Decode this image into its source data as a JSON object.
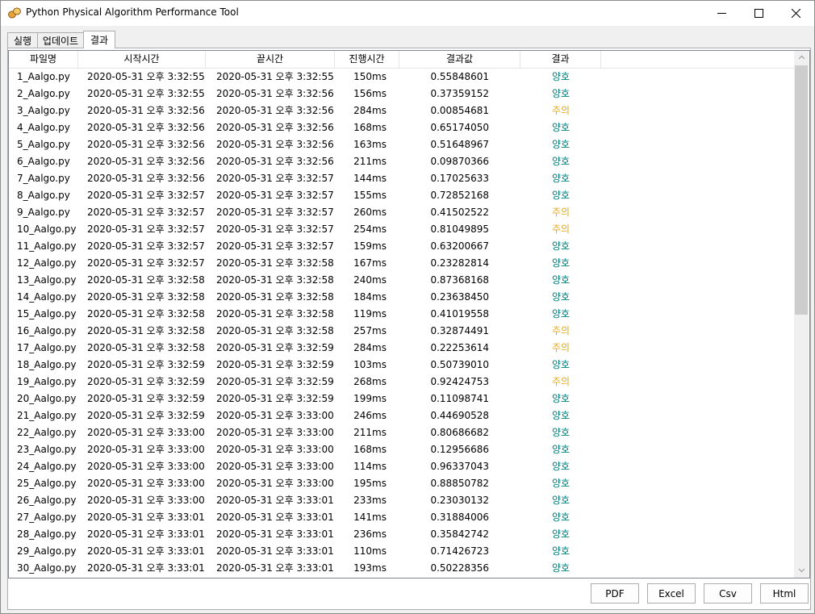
{
  "window": {
    "title": "Python Physical Algorithm Performance Tool"
  },
  "tabs": [
    {
      "label": "실행"
    },
    {
      "label": "업데이트"
    },
    {
      "label": "결과"
    }
  ],
  "columns": [
    "파일명",
    "시작시간",
    "끝시간",
    "진행시간",
    "결과값",
    "결과"
  ],
  "status_colors": {
    "good": "#007a7a",
    "caution": "#e6a817"
  },
  "rows": [
    {
      "file": "1_Aalgo.py",
      "start": "2020-05-31 오후 3:32:55",
      "end": "2020-05-31 오후 3:32:55",
      "duration": "150ms",
      "value": "0.55848601",
      "result": "양호",
      "status": "good"
    },
    {
      "file": "2_Aalgo.py",
      "start": "2020-05-31 오후 3:32:55",
      "end": "2020-05-31 오후 3:32:56",
      "duration": "156ms",
      "value": "0.37359152",
      "result": "양호",
      "status": "good"
    },
    {
      "file": "3_Aalgo.py",
      "start": "2020-05-31 오후 3:32:56",
      "end": "2020-05-31 오후 3:32:56",
      "duration": "284ms",
      "value": "0.00854681",
      "result": "주의",
      "status": "caution"
    },
    {
      "file": "4_Aalgo.py",
      "start": "2020-05-31 오후 3:32:56",
      "end": "2020-05-31 오후 3:32:56",
      "duration": "168ms",
      "value": "0.65174050",
      "result": "양호",
      "status": "good"
    },
    {
      "file": "5_Aalgo.py",
      "start": "2020-05-31 오후 3:32:56",
      "end": "2020-05-31 오후 3:32:56",
      "duration": "163ms",
      "value": "0.51648967",
      "result": "양호",
      "status": "good"
    },
    {
      "file": "6_Aalgo.py",
      "start": "2020-05-31 오후 3:32:56",
      "end": "2020-05-31 오후 3:32:56",
      "duration": "211ms",
      "value": "0.09870366",
      "result": "양호",
      "status": "good"
    },
    {
      "file": "7_Aalgo.py",
      "start": "2020-05-31 오후 3:32:56",
      "end": "2020-05-31 오후 3:32:57",
      "duration": "144ms",
      "value": "0.17025633",
      "result": "양호",
      "status": "good"
    },
    {
      "file": "8_Aalgo.py",
      "start": "2020-05-31 오후 3:32:57",
      "end": "2020-05-31 오후 3:32:57",
      "duration": "155ms",
      "value": "0.72852168",
      "result": "양호",
      "status": "good"
    },
    {
      "file": "9_Aalgo.py",
      "start": "2020-05-31 오후 3:32:57",
      "end": "2020-05-31 오후 3:32:57",
      "duration": "260ms",
      "value": "0.41502522",
      "result": "주의",
      "status": "caution"
    },
    {
      "file": "10_Aalgo.py",
      "start": "2020-05-31 오후 3:32:57",
      "end": "2020-05-31 오후 3:32:57",
      "duration": "254ms",
      "value": "0.81049895",
      "result": "주의",
      "status": "caution"
    },
    {
      "file": "11_Aalgo.py",
      "start": "2020-05-31 오후 3:32:57",
      "end": "2020-05-31 오후 3:32:57",
      "duration": "159ms",
      "value": "0.63200667",
      "result": "양호",
      "status": "good"
    },
    {
      "file": "12_Aalgo.py",
      "start": "2020-05-31 오후 3:32:57",
      "end": "2020-05-31 오후 3:32:58",
      "duration": "167ms",
      "value": "0.23282814",
      "result": "양호",
      "status": "good"
    },
    {
      "file": "13_Aalgo.py",
      "start": "2020-05-31 오후 3:32:58",
      "end": "2020-05-31 오후 3:32:58",
      "duration": "240ms",
      "value": "0.87368168",
      "result": "양호",
      "status": "good"
    },
    {
      "file": "14_Aalgo.py",
      "start": "2020-05-31 오후 3:32:58",
      "end": "2020-05-31 오후 3:32:58",
      "duration": "184ms",
      "value": "0.23638450",
      "result": "양호",
      "status": "good"
    },
    {
      "file": "15_Aalgo.py",
      "start": "2020-05-31 오후 3:32:58",
      "end": "2020-05-31 오후 3:32:58",
      "duration": "119ms",
      "value": "0.41019558",
      "result": "양호",
      "status": "good"
    },
    {
      "file": "16_Aalgo.py",
      "start": "2020-05-31 오후 3:32:58",
      "end": "2020-05-31 오후 3:32:58",
      "duration": "257ms",
      "value": "0.32874491",
      "result": "주의",
      "status": "caution"
    },
    {
      "file": "17_Aalgo.py",
      "start": "2020-05-31 오후 3:32:58",
      "end": "2020-05-31 오후 3:32:59",
      "duration": "284ms",
      "value": "0.22253614",
      "result": "주의",
      "status": "caution"
    },
    {
      "file": "18_Aalgo.py",
      "start": "2020-05-31 오후 3:32:59",
      "end": "2020-05-31 오후 3:32:59",
      "duration": "103ms",
      "value": "0.50739010",
      "result": "양호",
      "status": "good"
    },
    {
      "file": "19_Aalgo.py",
      "start": "2020-05-31 오후 3:32:59",
      "end": "2020-05-31 오후 3:32:59",
      "duration": "268ms",
      "value": "0.92424753",
      "result": "주의",
      "status": "caution"
    },
    {
      "file": "20_Aalgo.py",
      "start": "2020-05-31 오후 3:32:59",
      "end": "2020-05-31 오후 3:32:59",
      "duration": "199ms",
      "value": "0.11098741",
      "result": "양호",
      "status": "good"
    },
    {
      "file": "21_Aalgo.py",
      "start": "2020-05-31 오후 3:32:59",
      "end": "2020-05-31 오후 3:33:00",
      "duration": "246ms",
      "value": "0.44690528",
      "result": "양호",
      "status": "good"
    },
    {
      "file": "22_Aalgo.py",
      "start": "2020-05-31 오후 3:33:00",
      "end": "2020-05-31 오후 3:33:00",
      "duration": "211ms",
      "value": "0.80686682",
      "result": "양호",
      "status": "good"
    },
    {
      "file": "23_Aalgo.py",
      "start": "2020-05-31 오후 3:33:00",
      "end": "2020-05-31 오후 3:33:00",
      "duration": "168ms",
      "value": "0.12956686",
      "result": "양호",
      "status": "good"
    },
    {
      "file": "24_Aalgo.py",
      "start": "2020-05-31 오후 3:33:00",
      "end": "2020-05-31 오후 3:33:00",
      "duration": "114ms",
      "value": "0.96337043",
      "result": "양호",
      "status": "good"
    },
    {
      "file": "25_Aalgo.py",
      "start": "2020-05-31 오후 3:33:00",
      "end": "2020-05-31 오후 3:33:00",
      "duration": "195ms",
      "value": "0.88850782",
      "result": "양호",
      "status": "good"
    },
    {
      "file": "26_Aalgo.py",
      "start": "2020-05-31 오후 3:33:00",
      "end": "2020-05-31 오후 3:33:01",
      "duration": "233ms",
      "value": "0.23030132",
      "result": "양호",
      "status": "good"
    },
    {
      "file": "27_Aalgo.py",
      "start": "2020-05-31 오후 3:33:01",
      "end": "2020-05-31 오후 3:33:01",
      "duration": "141ms",
      "value": "0.31884006",
      "result": "양호",
      "status": "good"
    },
    {
      "file": "28_Aalgo.py",
      "start": "2020-05-31 오후 3:33:01",
      "end": "2020-05-31 오후 3:33:01",
      "duration": "236ms",
      "value": "0.35842742",
      "result": "양호",
      "status": "good"
    },
    {
      "file": "29_Aalgo.py",
      "start": "2020-05-31 오후 3:33:01",
      "end": "2020-05-31 오후 3:33:01",
      "duration": "110ms",
      "value": "0.71426723",
      "result": "양호",
      "status": "good"
    },
    {
      "file": "30_Aalgo.py",
      "start": "2020-05-31 오후 3:33:01",
      "end": "2020-05-31 오후 3:33:01",
      "duration": "193ms",
      "value": "0.50228356",
      "result": "양호",
      "status": "good"
    }
  ],
  "buttons": {
    "pdf": "PDF",
    "excel": "Excel",
    "csv": "Csv",
    "html": "Html"
  },
  "icons": {
    "app": "python-app-icon",
    "minimize": "minimize-icon",
    "maximize": "maximize-icon",
    "close": "close-icon",
    "scroll_up": "scroll-up-arrow-icon",
    "scroll_down": "scroll-down-arrow-icon"
  }
}
